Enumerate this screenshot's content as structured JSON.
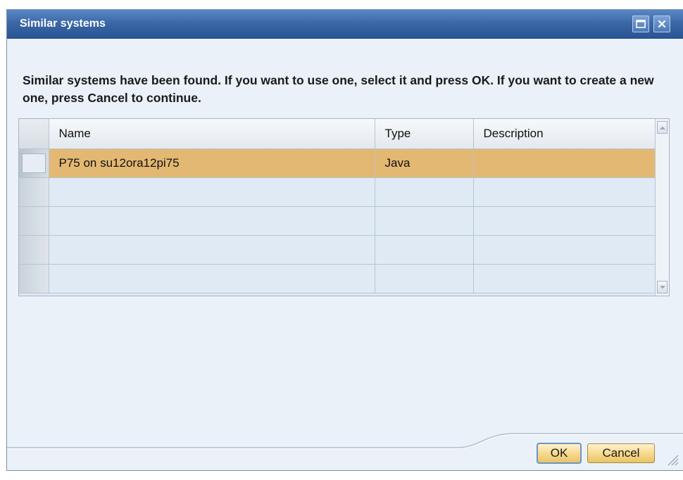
{
  "dialog": {
    "title": "Similar systems",
    "message": "Similar systems have been found. If you want to use one, select it and press OK. If you want to create a new one, press Cancel to continue."
  },
  "titlebar_buttons": {
    "maximize_icon": "maximize-icon",
    "close_icon": "close-icon"
  },
  "table": {
    "columns": [
      "Name",
      "Type",
      "Description"
    ],
    "rows": [
      {
        "name": "P75 on su12ora12pi75",
        "type": "Java",
        "description": "",
        "selected": true
      },
      {
        "name": "",
        "type": "",
        "description": "",
        "selected": false
      },
      {
        "name": "",
        "type": "",
        "description": "",
        "selected": false
      },
      {
        "name": "",
        "type": "",
        "description": "",
        "selected": false
      },
      {
        "name": "",
        "type": "",
        "description": "",
        "selected": false
      }
    ]
  },
  "buttons": {
    "ok": "OK",
    "cancel": "Cancel"
  },
  "colors": {
    "titlebar": "#3c68a8",
    "dialog_background": "#eaf1f8",
    "selected_row": "#e3b872",
    "button_fill": "#f5d88a"
  }
}
